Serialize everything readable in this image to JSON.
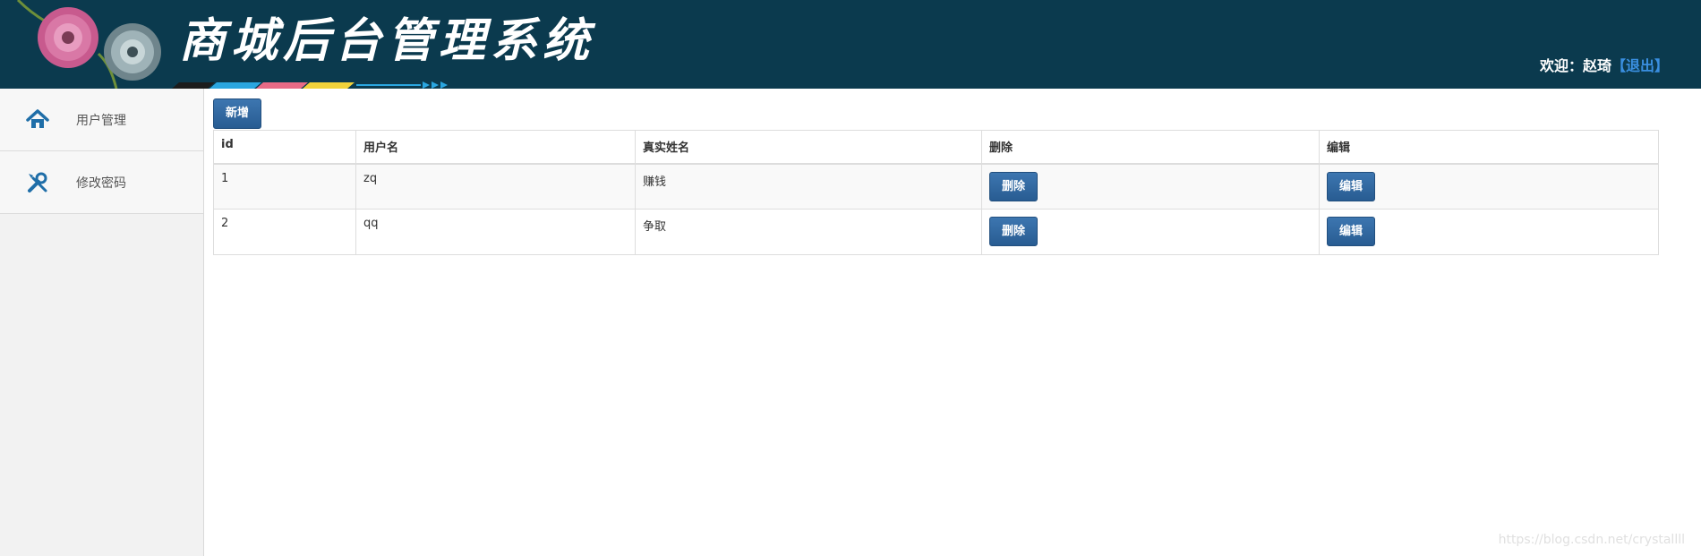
{
  "header": {
    "title": "商城后台管理系统",
    "welcome_prefix": "欢迎：",
    "username": "赵琦",
    "logout_label": "【退出】",
    "background_color": "#0b3a4e"
  },
  "sidebar": {
    "items": [
      {
        "icon": "home-icon",
        "label": "用户管理"
      },
      {
        "icon": "wrench-screwdriver-icon",
        "label": "修改密码"
      }
    ]
  },
  "toolbar": {
    "add_label": "新增"
  },
  "table": {
    "columns": [
      "id",
      "用户名",
      "真实姓名",
      "删除",
      "编辑"
    ],
    "rows": [
      {
        "id": "1",
        "username": "zq",
        "realname": "赚钱",
        "delete_label": "删除",
        "edit_label": "编辑"
      },
      {
        "id": "2",
        "username": "qq",
        "realname": "争取",
        "delete_label": "删除",
        "edit_label": "编辑"
      }
    ]
  },
  "watermark": "https://blog.csdn.net/crystallll",
  "colors": {
    "accent": "#2f679f",
    "link": "#3a8fe0"
  }
}
